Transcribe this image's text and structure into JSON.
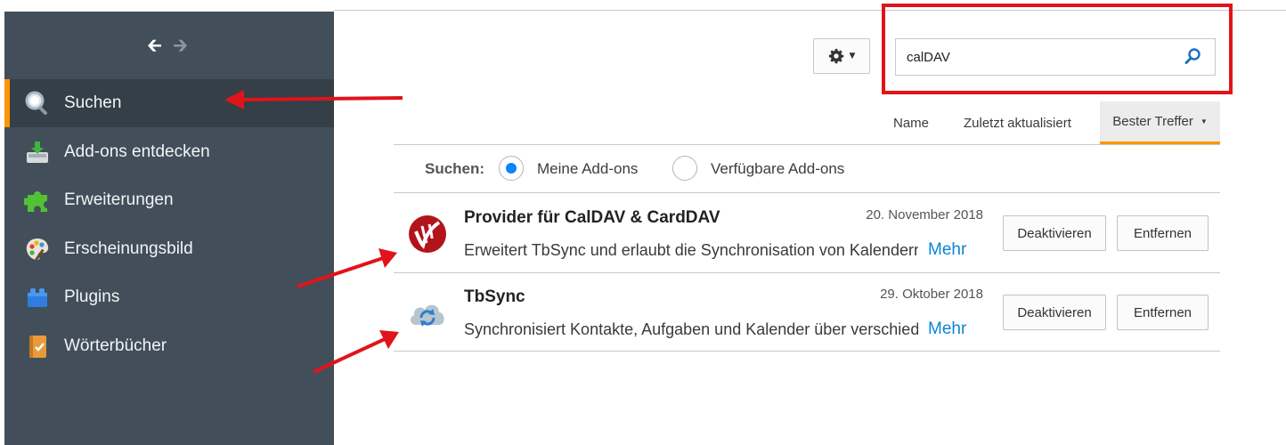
{
  "sidebar": {
    "nav_back_icon": "arrow-left-icon",
    "nav_forward_icon": "arrow-right-icon",
    "items": [
      {
        "label": "Suchen",
        "icon": "search-icon"
      },
      {
        "label": "Add-ons entdecken",
        "icon": "download-tray-icon"
      },
      {
        "label": "Erweiterungen",
        "icon": "puzzle-icon"
      },
      {
        "label": "Erscheinungsbild",
        "icon": "palette-icon"
      },
      {
        "label": "Plugins",
        "icon": "plugin-block-icon"
      },
      {
        "label": "Wörterbücher",
        "icon": "dictionary-icon"
      }
    ],
    "active_index": 0
  },
  "toolbar": {
    "gear_icon": "gear-icon",
    "search": {
      "value": "calDAV",
      "icon": "search-icon"
    }
  },
  "sort": {
    "name": "Name",
    "updated": "Zuletzt aktualisiert",
    "best": "Bester Treffer"
  },
  "filter": {
    "label": "Suchen:",
    "options": [
      "Meine Add-ons",
      "Verfügbare Add-ons"
    ],
    "selected": "Meine Add-ons"
  },
  "addons": [
    {
      "name": "Provider für CalDAV & CardDAV",
      "date": "20. November 2018",
      "description": "Erweitert TbSync und erlaubt die Synchronisation von Kalendern und Kontakten",
      "more": "Mehr",
      "deactivate": "Deaktivieren",
      "remove": "Entfernen"
    },
    {
      "name": "TbSync",
      "date": "29. Oktober 2018",
      "description": "Synchronisiert Kontakte, Aufgaben und Kalender über verschiedene Protokolle",
      "more": "Mehr",
      "deactivate": "Deaktivieren",
      "remove": "Entfernen"
    }
  ],
  "colors": {
    "sidebar_bg": "#424f5a",
    "accent": "#ff9500",
    "link": "#0a84d8",
    "annotation": "#e0141a"
  }
}
